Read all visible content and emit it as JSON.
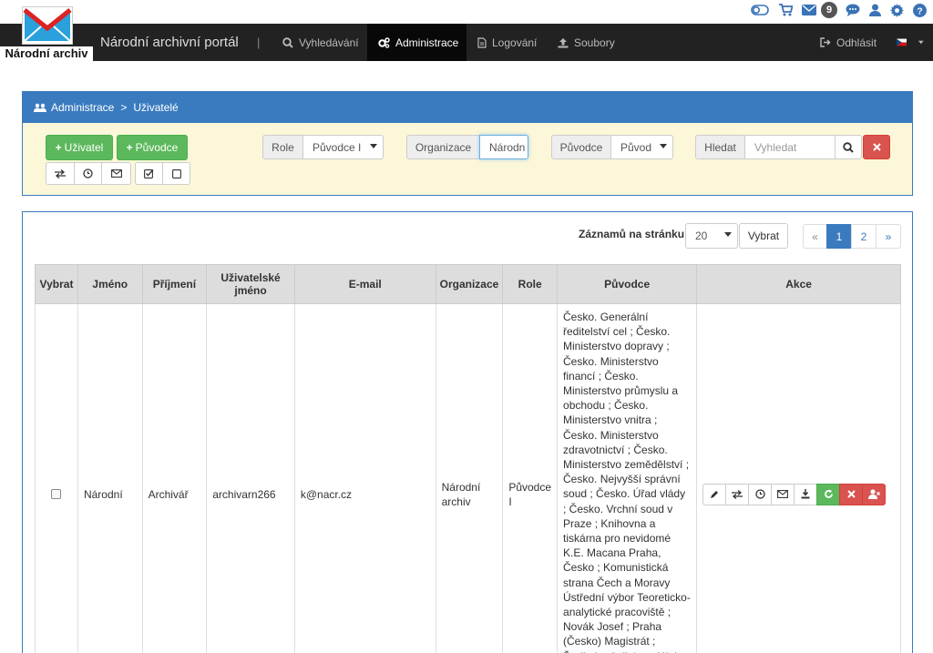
{
  "topbar": {
    "mail_count": "9"
  },
  "navbar": {
    "logo_text": "Národní archiv",
    "brand": "Národní archivní portál",
    "separator": "|",
    "items": [
      {
        "label": "Vyhledávání",
        "icon": "search-icon"
      },
      {
        "label": "Administrace",
        "icon": "cogs-icon"
      },
      {
        "label": "Logování",
        "icon": "file-icon"
      },
      {
        "label": "Soubory",
        "icon": "upload-icon"
      }
    ],
    "logout": "Odhlásit",
    "language": "cz-flag"
  },
  "panel": {
    "breadcrumb_root": "Administrace",
    "breadcrumb_sep": ">",
    "breadcrumb_current": "Uživatelé",
    "add_user": "Uživatel",
    "add_origin": "Původce",
    "role_label": "Role",
    "role_value": "Původce I",
    "org_label": "Organizace",
    "org_value": "Národn",
    "origin_label": "Původce",
    "origin_value": "Původ",
    "search_label": "Hledat",
    "search_placeholder": "Vyhledat"
  },
  "pager": {
    "label": "Záznamů na stránku:",
    "per_page": "20",
    "select_btn": "Vybrat",
    "prev": "«",
    "pages": [
      "1",
      "2"
    ],
    "next": "»"
  },
  "table": {
    "headers": [
      "Vybrat",
      "Jméno",
      "Příjmení",
      "Uživatelské jméno",
      "E-mail",
      "Organizace",
      "Role",
      "Původce",
      "Akce"
    ],
    "rows": [
      {
        "jmeno": "Národní",
        "prijmeni": "Archivář",
        "username": "archivarn266",
        "email": "k@nacr.cz",
        "organizace": "Národní archiv",
        "role": "Původce I",
        "puvodce": "Česko. Generální ředitelství cel ; Česko. Ministerstvo dopravy ; Česko. Ministerstvo financí ; Česko. Ministerstvo průmyslu a obchodu ; Česko. Ministerstvo vnitra ; Česko. Ministerstvo zdravotnictví ; Česko. Ministerstvo zemědělství ; Česko. Nejvyšší správní soud ; Česko. Úřad vlády ; Česko. Vrchní soud v Praze ; Knihovna a tiskárna pro nevidomé K.E. Macana Praha, Česko ; Komunistická strana Čech a Moravy Ústřední výbor Teoreticko-analytické pracoviště ; Novák Josef ; Praha (Česko) Magistrát ; Ředitelství silnic a dálnic ČR ; Úřad pro civilní"
      }
    ]
  },
  "colors": {
    "primary": "#3a7bbf",
    "success": "#5cb85c",
    "danger": "#d9534f",
    "navbar": "#222222",
    "panel_bg": "#fbf7d8"
  }
}
